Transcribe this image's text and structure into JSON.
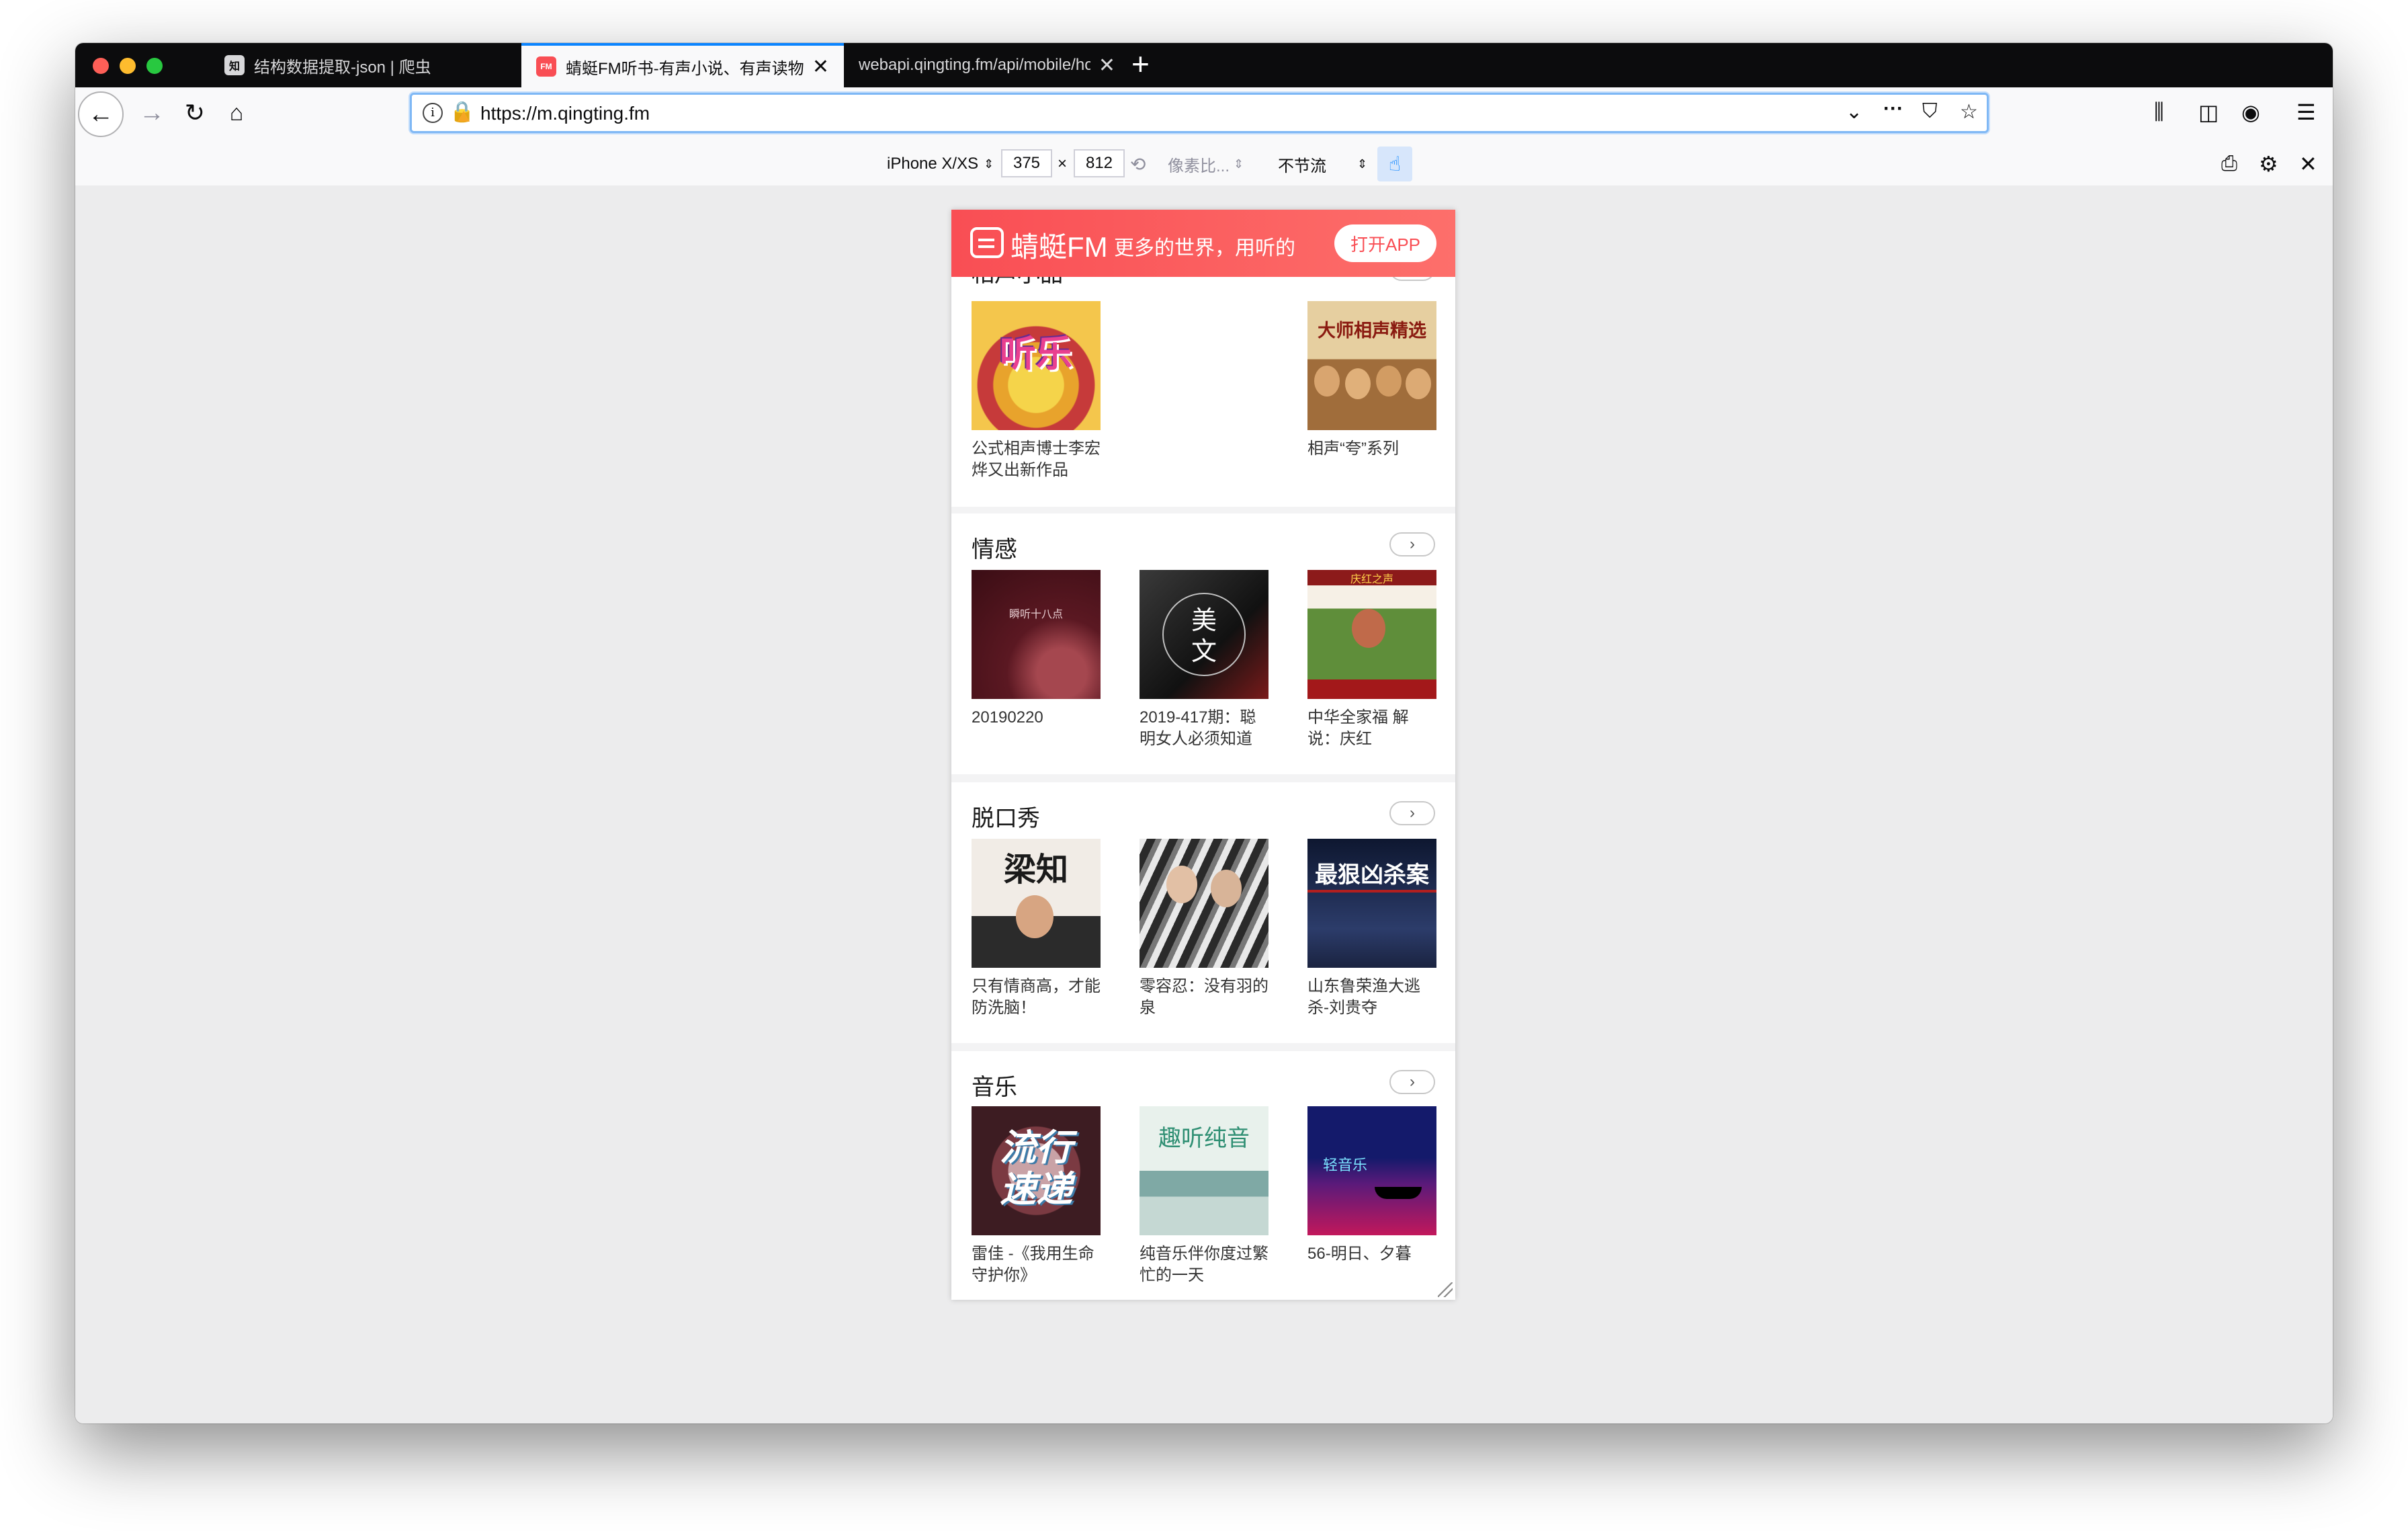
{
  "tabs": [
    {
      "title": "结构数据提取-json | 爬虫",
      "favicon": "知"
    },
    {
      "title": "蜻蜓FM听书-有声小说、有声读物",
      "favicon": "FM"
    },
    {
      "title": "webapi.qingting.fm/api/mobile/hom",
      "favicon": ""
    }
  ],
  "url": "https://m.qingting.fm",
  "rdm": {
    "device": "iPhone X/XS",
    "width": "375",
    "times": "×",
    "height": "812",
    "dpr": "像素比...",
    "throttle": "不节流"
  },
  "banner": {
    "brand": "蜻蜓FM",
    "slogan": "更多的世界，用听的",
    "open_app": "打开APP"
  },
  "sections": [
    {
      "title": "相声小品",
      "items": [
        {
          "caption": "公式相声博士李宏烨又出新作品",
          "cover_text": "听乐"
        },
        {
          "caption": "相声“夸”系列",
          "cover_text": "大师相声精选"
        }
      ]
    },
    {
      "title": "情感",
      "items": [
        {
          "caption": "20190220",
          "cover_text": "瞬听十八点"
        },
        {
          "caption": "2019-417期：聪明女人必须知道",
          "cover_text": "美 文"
        },
        {
          "caption": "中华全家福 解说：庆红",
          "cover_text": "庆红之声"
        }
      ]
    },
    {
      "title": "脱口秀",
      "items": [
        {
          "caption": "只有情商高，才能防洗脑！",
          "cover_text": "梁知"
        },
        {
          "caption": "零容忍：没有羽的泉",
          "cover_text": ""
        },
        {
          "caption": "山东鲁荣渔大逃杀-刘贵夺",
          "cover_text": "最狠凶杀案"
        }
      ]
    },
    {
      "title": "音乐",
      "items": [
        {
          "caption": "雷佳 -《我用生命守护你》",
          "cover_text": "流行速递"
        },
        {
          "caption": "纯音乐伴你度过繁忙的一天",
          "cover_text": "趣听纯音"
        },
        {
          "caption": "56-明日、夕暮",
          "cover_text": "轻音乐"
        }
      ]
    }
  ],
  "icons": {
    "back": "arrow-left-icon",
    "forward": "arrow-right-icon",
    "reload": "reload-icon",
    "home": "home-icon",
    "library": "library-icon",
    "sidebar": "sidebar-icon",
    "account": "account-icon",
    "menu": "hamburger-menu-icon"
  },
  "colors": {
    "brand_red": "#f94e54",
    "accent_blue": "#0a84ff"
  }
}
